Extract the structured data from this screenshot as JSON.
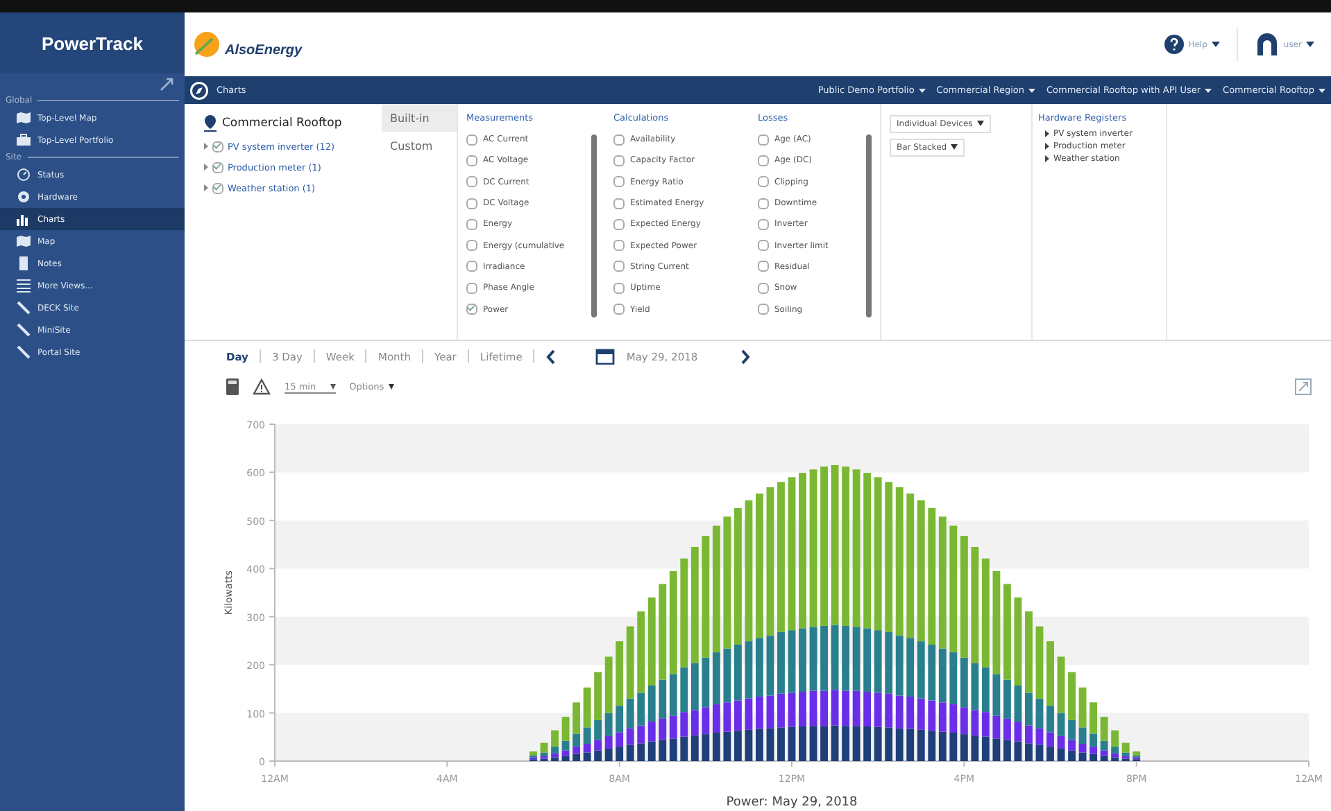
{
  "sidebar": {
    "title": "PowerTrack",
    "sections": [
      {
        "label": "Global",
        "items": [
          {
            "label": "Top-Level Map",
            "selected": false
          },
          {
            "label": "Top-Level Portfolio",
            "selected": false
          }
        ]
      },
      {
        "label": "Site",
        "items": [
          {
            "label": "Status",
            "selected": false
          },
          {
            "label": "Hardware",
            "selected": false
          },
          {
            "label": "Charts",
            "selected": true
          },
          {
            "label": "Map",
            "selected": false
          },
          {
            "label": "Notes",
            "selected": false
          },
          {
            "label": "More Views...",
            "selected": false
          },
          {
            "label": "DECK Site",
            "selected": false
          },
          {
            "label": "MiniSite",
            "selected": false
          },
          {
            "label": "Portal Site",
            "selected": false
          }
        ]
      }
    ]
  },
  "header": {
    "logo": "AlsoEnergy",
    "help": "Help",
    "user": "user"
  },
  "nav_bar": {
    "title": "Charts",
    "breadcrumbs": [
      "Public Demo Portfolio",
      "Commercial Region",
      "Commercial Rooftop with API User",
      "Commercial Rooftop"
    ]
  },
  "site_tree": {
    "title": "Commercial Rooftop",
    "items": [
      {
        "label": "PV system inverter (12)",
        "checked": true
      },
      {
        "label": "Production meter (1)",
        "checked": true
      },
      {
        "label": "Weather station (1)",
        "checked": true
      }
    ]
  },
  "mode_tabs": [
    {
      "label": "Built-in",
      "selected": true
    },
    {
      "label": "Custom",
      "selected": false
    }
  ],
  "groups": [
    {
      "title": "Measurements",
      "items": [
        {
          "label": "AC Current",
          "checked": false
        },
        {
          "label": "AC Voltage",
          "checked": false
        },
        {
          "label": "DC Current",
          "checked": false
        },
        {
          "label": "DC Voltage",
          "checked": false
        },
        {
          "label": "Energy",
          "checked": false
        },
        {
          "label": "Energy (cumulative",
          "checked": false
        },
        {
          "label": "Irradiance",
          "checked": false
        },
        {
          "label": "Phase Angle",
          "checked": false
        },
        {
          "label": "Power",
          "checked": true
        }
      ]
    },
    {
      "title": "Calculations",
      "items": [
        {
          "label": "Availability",
          "checked": false
        },
        {
          "label": "Capacity Factor",
          "checked": false
        },
        {
          "label": "Energy Ratio",
          "checked": false
        },
        {
          "label": "Estimated Energy",
          "checked": false
        },
        {
          "label": "Expected Energy",
          "checked": false
        },
        {
          "label": "Expected Power",
          "checked": false
        },
        {
          "label": "String Current",
          "checked": false
        },
        {
          "label": "Uptime",
          "checked": false
        },
        {
          "label": "Yield",
          "checked": false
        }
      ]
    },
    {
      "title": "Losses",
      "items": [
        {
          "label": "Age (AC)",
          "checked": false
        },
        {
          "label": "Age (DC)",
          "checked": false
        },
        {
          "label": "Clipping",
          "checked": false
        },
        {
          "label": "Downtime",
          "checked": false
        },
        {
          "label": "Inverter",
          "checked": false
        },
        {
          "label": "Inverter limit",
          "checked": false
        },
        {
          "label": "Residual",
          "checked": false
        },
        {
          "label": "Snow",
          "checked": false
        },
        {
          "label": "Soiling",
          "checked": false
        }
      ]
    }
  ],
  "selects": [
    "Individual Devices",
    "Bar Stacked"
  ],
  "hardware_registers": {
    "title": "Hardware Registers",
    "items": [
      "PV system inverter",
      "Production meter",
      "Weather station"
    ]
  },
  "ranges": [
    {
      "label": "Day",
      "selected": true
    },
    {
      "label": "3 Day",
      "selected": false
    },
    {
      "label": "Week",
      "selected": false
    },
    {
      "label": "Month",
      "selected": false
    },
    {
      "label": "Year",
      "selected": false
    },
    {
      "label": "Lifetime",
      "selected": false
    }
  ],
  "date": "May 29, 2018",
  "interval": "15 min",
  "options": "Options",
  "chart": {
    "chart_data": {
      "type": "bar",
      "stacked": true,
      "title": "Power: May 29, 2018",
      "ylabel": "Kilowatts",
      "ylim": [
        0,
        700
      ],
      "yticks": [
        0,
        100,
        200,
        300,
        400,
        500,
        600,
        700
      ],
      "categories": [
        "12AM",
        null,
        null,
        null,
        null,
        null,
        null,
        null,
        null,
        null,
        null,
        null,
        null,
        null,
        null,
        null,
        "4AM",
        null,
        null,
        null,
        null,
        null,
        null,
        null,
        null,
        null,
        null,
        null,
        null,
        null,
        null,
        null,
        "8AM",
        null,
        null,
        null,
        null,
        null,
        null,
        null,
        null,
        null,
        null,
        null,
        null,
        null,
        null,
        null,
        "12PM",
        null,
        null,
        null,
        null,
        null,
        null,
        null,
        null,
        null,
        null,
        null,
        null,
        null,
        null,
        null,
        "4PM",
        null,
        null,
        null,
        null,
        null,
        null,
        null,
        null,
        null,
        null,
        null,
        null,
        null,
        null,
        null,
        "8PM",
        null,
        null,
        null,
        null,
        null,
        null,
        null,
        null,
        null,
        null,
        null,
        null,
        null,
        null,
        null,
        "12AM"
      ],
      "series": [
        {
          "color": "#1f3f7a",
          "values": [
            null,
            null,
            null,
            null,
            null,
            null,
            null,
            null,
            null,
            null,
            null,
            null,
            null,
            null,
            null,
            null,
            null,
            null,
            null,
            null,
            null,
            null,
            null,
            null,
            4,
            5,
            8,
            11,
            15,
            18,
            22,
            26,
            30,
            34,
            37,
            41,
            44,
            47,
            51,
            53,
            56,
            59,
            61,
            63,
            65,
            67,
            68,
            70,
            71,
            72,
            73,
            73,
            74,
            73,
            73,
            72,
            71,
            70,
            68,
            67,
            65,
            63,
            61,
            59,
            56,
            53,
            51,
            47,
            44,
            41,
            37,
            34,
            30,
            26,
            22,
            18,
            15,
            11,
            8,
            5,
            4,
            null,
            null,
            null,
            null,
            null,
            null,
            null,
            null,
            null,
            null,
            null,
            null,
            null,
            null,
            null,
            null
          ]
        },
        {
          "color": "#6a2ee8",
          "values": [
            null,
            null,
            null,
            null,
            null,
            null,
            null,
            null,
            null,
            null,
            null,
            null,
            null,
            null,
            null,
            null,
            null,
            null,
            null,
            null,
            null,
            null,
            null,
            null,
            4,
            5,
            8,
            11,
            15,
            18,
            22,
            26,
            30,
            34,
            37,
            41,
            44,
            47,
            51,
            53,
            56,
            59,
            61,
            63,
            65,
            67,
            68,
            70,
            71,
            72,
            73,
            73,
            74,
            73,
            73,
            72,
            71,
            70,
            68,
            67,
            65,
            63,
            61,
            59,
            56,
            53,
            51,
            47,
            44,
            41,
            37,
            34,
            30,
            26,
            22,
            18,
            15,
            11,
            8,
            5,
            4,
            null,
            null,
            null,
            null,
            null,
            null,
            null,
            null,
            null,
            null,
            null,
            null,
            null,
            null,
            null,
            null
          ]
        },
        {
          "color": "#2a7f8f",
          "values": [
            null,
            null,
            null,
            null,
            null,
            null,
            null,
            null,
            null,
            null,
            null,
            null,
            null,
            null,
            null,
            null,
            null,
            null,
            null,
            null,
            null,
            null,
            null,
            null,
            4,
            8,
            14,
            20,
            27,
            34,
            41,
            48,
            55,
            62,
            68,
            75,
            81,
            87,
            93,
            98,
            103,
            108,
            112,
            116,
            119,
            122,
            125,
            128,
            130,
            132,
            133,
            135,
            135,
            135,
            133,
            132,
            130,
            128,
            125,
            122,
            119,
            116,
            112,
            108,
            103,
            98,
            93,
            87,
            81,
            75,
            68,
            62,
            55,
            48,
            41,
            34,
            27,
            20,
            14,
            8,
            4,
            null,
            null,
            null,
            null,
            null,
            null,
            null,
            null,
            null,
            null,
            null,
            null,
            null,
            null,
            null,
            null
          ]
        },
        {
          "color": "#7ab833",
          "values": [
            null,
            null,
            null,
            null,
            null,
            null,
            null,
            null,
            null,
            null,
            null,
            null,
            null,
            null,
            null,
            null,
            null,
            null,
            null,
            null,
            null,
            null,
            null,
            null,
            8,
            20,
            34,
            50,
            65,
            83,
            100,
            117,
            134,
            150,
            169,
            183,
            199,
            214,
            226,
            241,
            253,
            263,
            274,
            284,
            293,
            300,
            308,
            312,
            318,
            323,
            327,
            331,
            332,
            331,
            327,
            323,
            318,
            312,
            308,
            300,
            293,
            284,
            274,
            263,
            253,
            241,
            226,
            214,
            199,
            183,
            169,
            150,
            134,
            117,
            100,
            83,
            65,
            50,
            34,
            20,
            8,
            null,
            null,
            null,
            null,
            null,
            null,
            null,
            null,
            null,
            null,
            null,
            null,
            null,
            null,
            null,
            null
          ]
        }
      ]
    }
  }
}
